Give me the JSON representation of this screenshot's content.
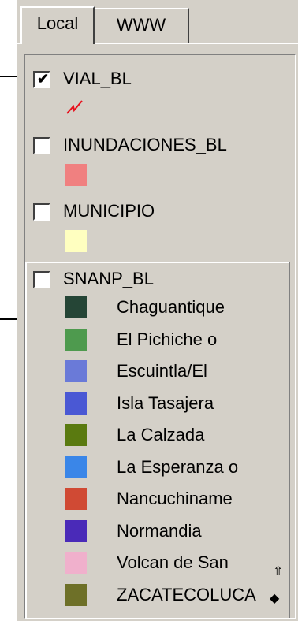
{
  "tabs": [
    {
      "label": "Local"
    },
    {
      "label": "WWW"
    }
  ],
  "layers": [
    {
      "name": "VIAL_BL",
      "checked": true,
      "swatch_icon": "line-symbol-icon",
      "color": "#e8101c"
    },
    {
      "name": "INUNDACIONES_BL",
      "checked": false,
      "color": "#f08080"
    },
    {
      "name": "MUNICIPIO",
      "checked": false,
      "color": "#ffffc0"
    },
    {
      "name": "SNANP_BL",
      "checked": false,
      "categories": [
        {
          "label": "Chaguantique",
          "color": "#254536"
        },
        {
          "label": "El Pichiche o",
          "color": "#4e9a4e"
        },
        {
          "label": "Escuintla/El",
          "color": "#6a7ad8"
        },
        {
          "label": "Isla Tasajera",
          "color": "#4a58d4"
        },
        {
          "label": "La Calzada",
          "color": "#5a7a10"
        },
        {
          "label": "La Esperanza o",
          "color": "#3a86e8"
        },
        {
          "label": "Nancuchiname",
          "color": "#d04a34"
        },
        {
          "label": "Normandia",
          "color": "#4a2ab8"
        },
        {
          "label": "Volcan de San",
          "color": "#f0b0cc"
        },
        {
          "label": "ZACATECOLUCA",
          "color": "#6e7028"
        }
      ]
    }
  ],
  "checkmark": "✔",
  "scroll_icons": {
    "up": "up-arrow-icon",
    "down": "down-arrow-icon"
  }
}
